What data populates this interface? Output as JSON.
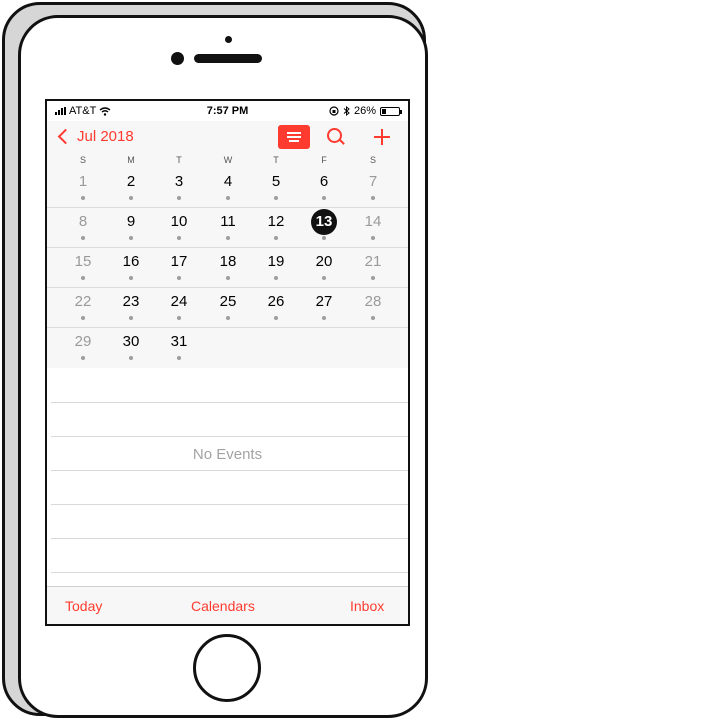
{
  "status_bar": {
    "carrier": "AT&T",
    "time": "7:57 PM",
    "battery": "26%",
    "battery_level": 0.26,
    "icons": [
      "signal-bars-icon",
      "wifi-icon",
      "orientation-lock-icon",
      "bluetooth-icon",
      "battery-icon"
    ]
  },
  "nav": {
    "back_label": "Jul 2018",
    "buttons": [
      "list-view-icon",
      "search-icon",
      "add-icon"
    ]
  },
  "weekdays": [
    "S",
    "M",
    "T",
    "W",
    "T",
    "F",
    "S"
  ],
  "month": {
    "today": "13",
    "weeks": [
      [
        "",
        "",
        "",
        "",
        "",
        "",
        ""
      ],
      [
        "1",
        "2",
        "3",
        "4",
        "5",
        "6",
        "7"
      ],
      [
        "8",
        "9",
        "10",
        "11",
        "12",
        "13",
        "14"
      ],
      [
        "15",
        "16",
        "17",
        "18",
        "19",
        "20",
        "21"
      ],
      [
        "22",
        "23",
        "24",
        "25",
        "26",
        "27",
        "28"
      ],
      [
        "29",
        "30",
        "31",
        "",
        "",
        "",
        ""
      ]
    ]
  },
  "events": {
    "empty_label": "No Events"
  },
  "tabbar": {
    "today": "Today",
    "calendars": "Calendars",
    "inbox": "Inbox"
  },
  "colors": {
    "accent": "#ff3b30",
    "today_circle": "#111111",
    "weekend_text": "#9a9a9a"
  }
}
